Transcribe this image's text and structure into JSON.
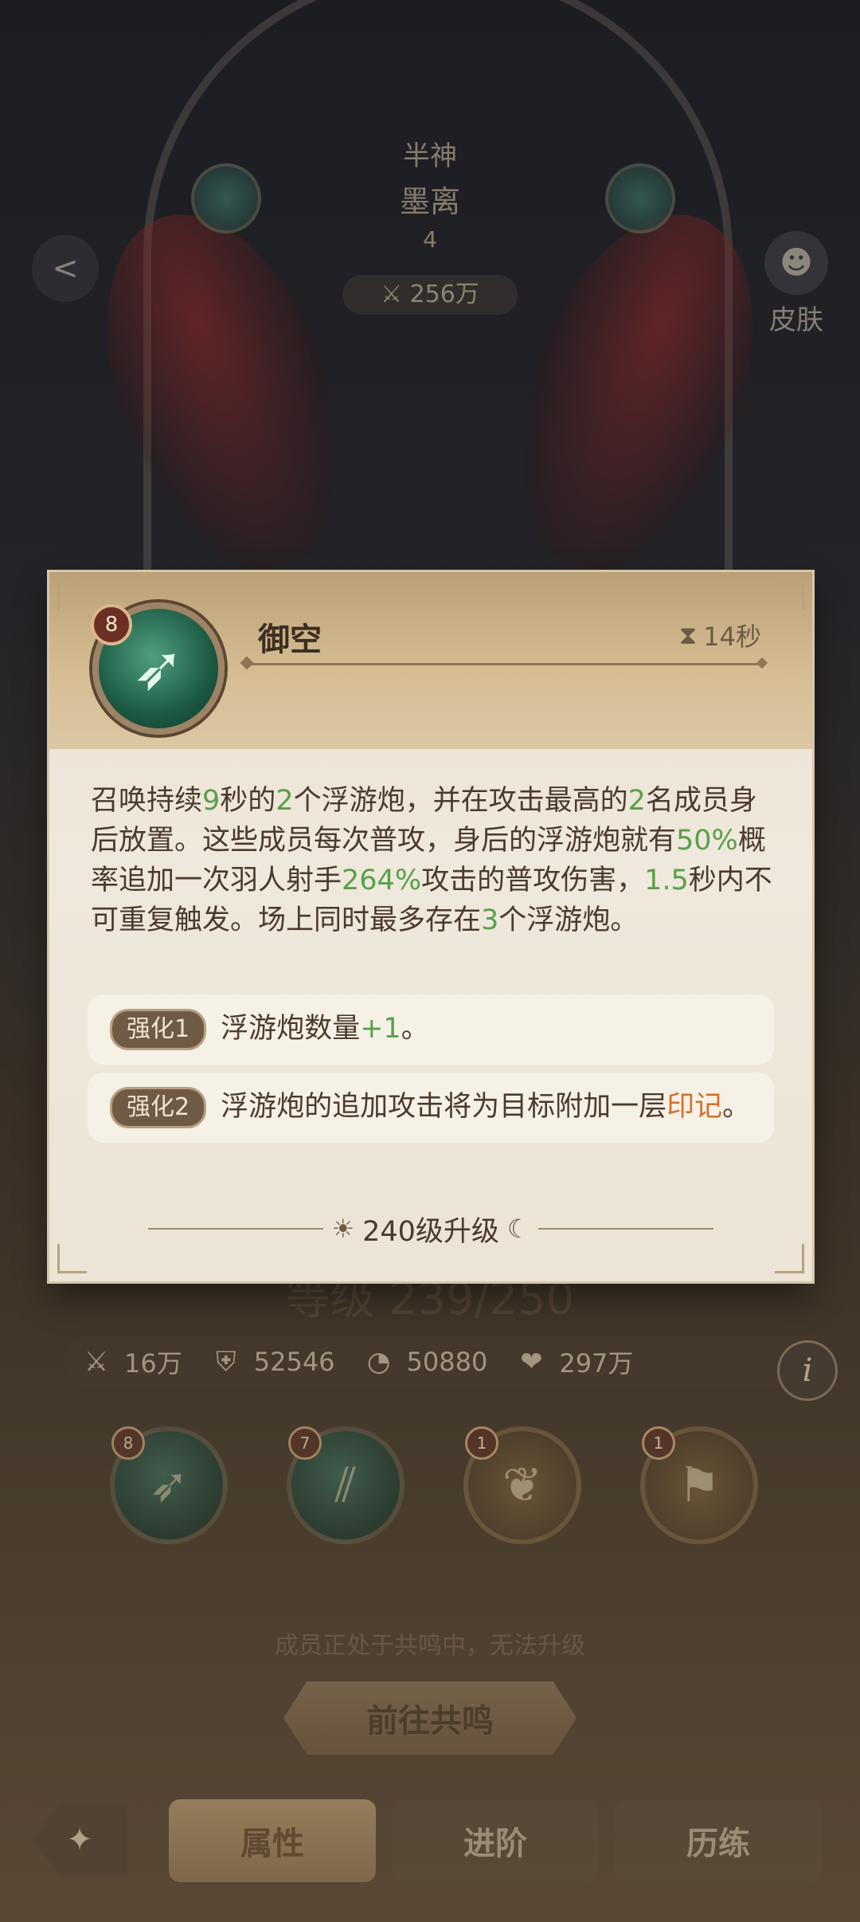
{
  "background": {
    "hero_class": "半神",
    "hero_name": "墨离",
    "hero_number": "4",
    "hero_power": "256万",
    "skin_label": "皮肤",
    "level_text": "等级 239/250"
  },
  "stats": {
    "attack": "16万",
    "defense": "52546",
    "speed": "50880",
    "hp": "297万"
  },
  "skills": [
    {
      "level": "8",
      "icon": "bow-arrow-icon"
    },
    {
      "level": "7",
      "icon": "claw-slash-icon"
    },
    {
      "level": "1",
      "icon": "flame-wing-icon"
    },
    {
      "level": "1",
      "icon": "banner-icon"
    }
  ],
  "resonance_note": "成员正处于共鸣中，无法升级",
  "goto_button": "前往共鸣",
  "nav": {
    "tab_attributes": "属性",
    "tab_advance": "进阶",
    "tab_training": "历练"
  },
  "panel": {
    "skill_level": "8",
    "skill_name": "御空",
    "cooldown": "14秒",
    "desc": [
      "召唤持续",
      "9",
      "秒的",
      "2",
      "个浮游炮，并在攻击最高的",
      "2",
      "名成员身后放置。这些成员每次普攻，身后的浮游炮就有",
      "50%",
      "概率追加一次羽人射手",
      "264%",
      "攻击的普攻伤害，",
      "1.5",
      "秒内不可重复触发。场上同时最多存在",
      "3",
      "个浮游炮。"
    ],
    "enh1": {
      "tag": "强化1",
      "text_a": "浮游炮数量",
      "num": "+1",
      "text_b": "。"
    },
    "enh2": {
      "tag": "强化2",
      "text_a": "浮游炮的追加攻击将为目标附加一层",
      "hl": "印记",
      "text_b": "。"
    },
    "upgrade": "240级升级"
  },
  "colors": {
    "number_green": "#58a14a",
    "highlight_orange": "#d2702a",
    "panel_paper": "#efe8dc"
  }
}
